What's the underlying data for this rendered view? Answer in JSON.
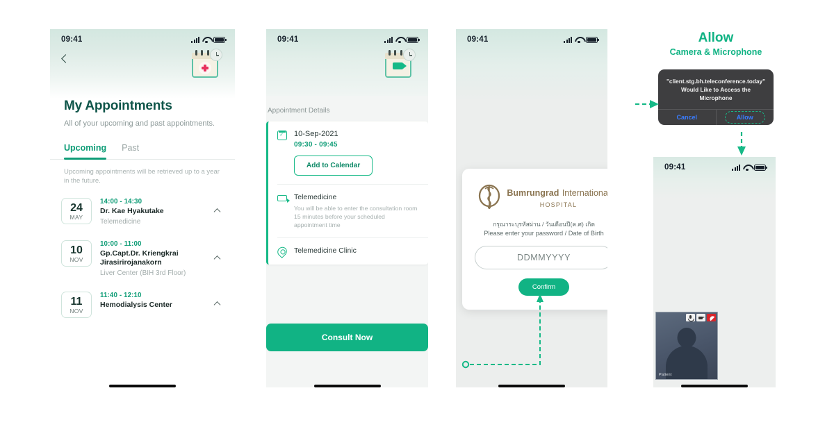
{
  "panel1": {
    "status": {
      "time": "09:41"
    },
    "back_icon": "chevron-left-icon",
    "hero_icon": "calendar-medical-icon",
    "title": "My Appointments",
    "subtitle": "All of your upcoming and past appointments.",
    "tabs": [
      {
        "label": "Upcoming",
        "active": true
      },
      {
        "label": "Past",
        "active": false
      }
    ],
    "note": "Upcoming appointments will be retrieved up to a year in the future.",
    "appointments": [
      {
        "day": "24",
        "month": "MAY",
        "time": "14:00 - 14:30",
        "name": "Dr. Kae Hyakutake",
        "location": "Telemedicine"
      },
      {
        "day": "10",
        "month": "NOV",
        "time": "10:00 - 11:00",
        "name": "Gp.Capt.Dr. Kriengkrai Jirasirirojanakorn",
        "location": "Liver Center (BIH 3rd Floor)"
      },
      {
        "day": "11",
        "month": "NOV",
        "time": "11:40 - 12:10",
        "name": "Hemodialysis Center",
        "location": ""
      }
    ]
  },
  "panel2": {
    "status": {
      "time": "09:41"
    },
    "hero_icon": "calendar-video-icon",
    "section_label": "Appointment Details",
    "date": "10-Sep-2021",
    "time": "09:30 - 09:45",
    "add_to_calendar_label": "Add to Calendar",
    "telemedicine_title": "Telemedicine",
    "telemedicine_desc": "You will be able to enter the consultation room 15 minutes before your scheduled appointment time",
    "clinic": "Telemedicine Clinic",
    "consult_label": "Consult Now"
  },
  "panel3": {
    "status": {
      "time": "09:41"
    },
    "logo": {
      "line1": "Bumrungrad",
      "line2": "International",
      "line3": "HOSPITAL"
    },
    "prompt_th": "กรุณาระบุรหัสผ่าน / วันเดือนปี(ค.ศ) เกิด",
    "prompt_en": "Please enter your password / Date of Birth",
    "input_placeholder": "DDMMYYYY",
    "input_value": "DDMMYYYY",
    "confirm_label": "Confirm"
  },
  "panel4": {
    "heading_line1": "Allow",
    "heading_line2": "Camera & Microphone",
    "permission_text": "\"client.stg.bh.teleconference.today\" Would Like to Access the Microphone",
    "cancel_label": "Cancel",
    "allow_label": "Allow",
    "status": {
      "time": "09:41"
    },
    "video_tile": {
      "participant_name": "Patient",
      "controls": [
        "mic-icon",
        "camera-icon",
        "hangup-icon"
      ]
    }
  },
  "colors": {
    "brand_green": "#11b384",
    "dark_green": "#10564a",
    "accent_pink": "#e8315f",
    "logo_brown": "#8a7450",
    "dialog_blue": "#3a7dff"
  }
}
